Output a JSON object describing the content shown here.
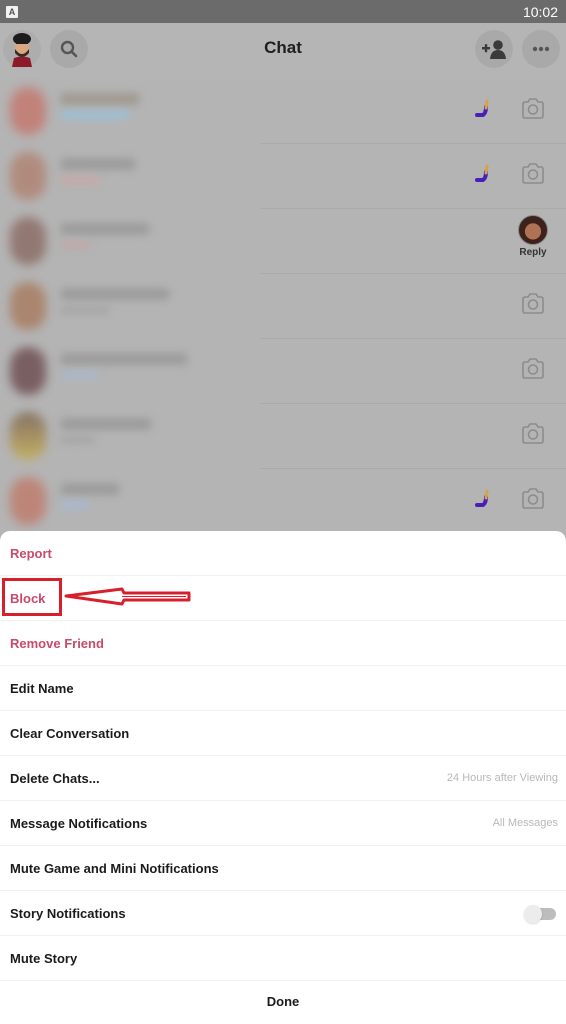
{
  "status_bar": {
    "app_icon": "A",
    "time": "10:02"
  },
  "header": {
    "title": "Chat",
    "avatar_icon": "bitmoji-avatar",
    "search_icon": "search-icon",
    "add_friend_icon": "add-friend-icon",
    "more_icon": "more-icon"
  },
  "chat_list": {
    "rows": [
      {
        "name": "[blurred]",
        "indicator": "wave-emoji",
        "action": "camera"
      },
      {
        "name": "[blurred]",
        "indicator": "wave-emoji",
        "action": "camera"
      },
      {
        "name": "[blurred]",
        "indicator": "",
        "action": "reply",
        "action_label": "Reply"
      },
      {
        "name": "[blurred]",
        "indicator": "",
        "action": "camera"
      },
      {
        "name": "[blurred]",
        "indicator": "",
        "action": "camera"
      },
      {
        "name": "[blurred]",
        "indicator": "",
        "action": "camera"
      },
      {
        "name": "[blurred]",
        "indicator": "wave-emoji",
        "action": "camera"
      }
    ]
  },
  "sheet": {
    "items": [
      {
        "label": "Report",
        "style": "danger"
      },
      {
        "label": "Block",
        "style": "danger",
        "highlighted": true
      },
      {
        "label": "Remove Friend",
        "style": "danger"
      },
      {
        "label": "Edit Name"
      },
      {
        "label": "Clear Conversation"
      },
      {
        "label": "Delete Chats...",
        "value": "24 Hours after Viewing"
      },
      {
        "label": "Message Notifications",
        "value": "All Messages"
      },
      {
        "label": "Mute Game and Mini Notifications"
      },
      {
        "label": "Story Notifications",
        "toggle": false
      },
      {
        "label": "Mute Story"
      }
    ],
    "done_label": "Done"
  },
  "colors": {
    "danger": "#c94a6a",
    "annotation": "#d8202c",
    "wave_purple": "#4a1fb8"
  }
}
